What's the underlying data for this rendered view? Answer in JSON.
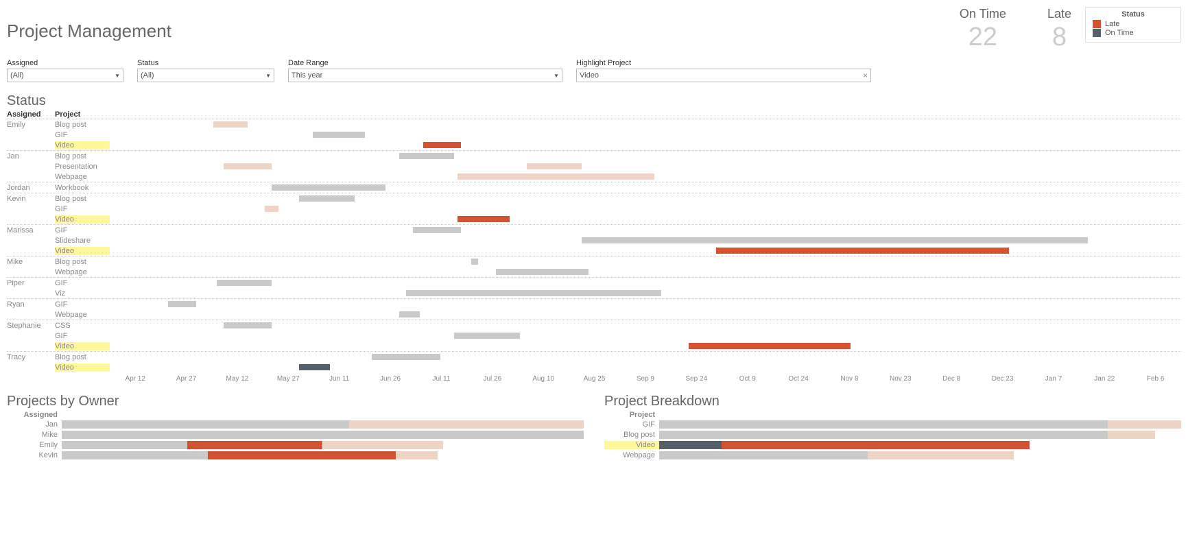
{
  "title": "Project Management",
  "kpis": {
    "ontime_label": "On Time",
    "ontime_value": "22",
    "late_label": "Late",
    "late_value": "8"
  },
  "legend": {
    "title": "Status",
    "late": "Late",
    "ontime": "On Time"
  },
  "filters": {
    "assigned": {
      "label": "Assigned",
      "value": "(All)"
    },
    "status": {
      "label": "Status",
      "value": "(All)"
    },
    "daterange": {
      "label": "Date Range",
      "value": "This year"
    },
    "highlight": {
      "label": "Highlight Project",
      "value": "Video"
    }
  },
  "status_section_title": "Status",
  "gantt_headers": {
    "assigned": "Assigned",
    "project": "Project"
  },
  "axis_labels": [
    "Apr 12",
    "Apr 27",
    "May 12",
    "May 27",
    "Jun 11",
    "Jun 26",
    "Jul 11",
    "Jul 26",
    "Aug 10",
    "Aug 25",
    "Sep 9",
    "Sep 24",
    "Oct 9",
    "Oct 24",
    "Nov 8",
    "Nov 23",
    "Dec 8",
    "Dec 23",
    "Jan 7",
    "Jan 22",
    "Feb 6"
  ],
  "projects_by_owner_title": "Projects by Owner",
  "projects_by_owner_header": "Assigned",
  "project_breakdown_title": "Project Breakdown",
  "project_breakdown_header": "Project",
  "colors": {
    "late": "#d35231",
    "ontime_dark": "#56606a",
    "ontime_light": "#c9c9c9",
    "shadow": "#eed4c4",
    "highlight": "#fff79a"
  },
  "chart_data": [
    {
      "name": "status_gantt",
      "type": "gantt",
      "x_axis_type": "date",
      "x_range": [
        "2023-04-05",
        "2024-02-10"
      ],
      "highlight_project": "Video",
      "rows": [
        {
          "assigned": "Emily",
          "project": "Blog post",
          "bars": [
            {
              "start": "2023-05-05",
              "end": "2023-05-15",
              "status": "shadow"
            }
          ]
        },
        {
          "assigned": "Emily",
          "project": "GIF",
          "bars": [
            {
              "start": "2023-06-03",
              "end": "2023-06-18",
              "status": "ontime"
            }
          ]
        },
        {
          "assigned": "Emily",
          "project": "Video",
          "bars": [
            {
              "start": "2023-07-05",
              "end": "2023-07-16",
              "status": "late"
            }
          ],
          "highlight": true
        },
        {
          "assigned": "Jan",
          "project": "Blog post",
          "bars": [
            {
              "start": "2023-06-28",
              "end": "2023-07-14",
              "status": "ontime"
            }
          ]
        },
        {
          "assigned": "Jan",
          "project": "Presentation",
          "bars": [
            {
              "start": "2023-05-08",
              "end": "2023-05-22",
              "status": "shadow"
            },
            {
              "start": "2023-08-04",
              "end": "2023-08-20",
              "status": "shadow"
            }
          ]
        },
        {
          "assigned": "Jan",
          "project": "Webpage",
          "bars": [
            {
              "start": "2023-07-15",
              "end": "2023-09-10",
              "status": "shadow"
            }
          ]
        },
        {
          "assigned": "Jordan",
          "project": "Workbook",
          "bars": [
            {
              "start": "2023-05-22",
              "end": "2023-06-24",
              "status": "ontime"
            }
          ]
        },
        {
          "assigned": "Kevin",
          "project": "Blog post",
          "bars": [
            {
              "start": "2023-05-30",
              "end": "2023-06-15",
              "status": "ontime"
            }
          ]
        },
        {
          "assigned": "Kevin",
          "project": "GIF",
          "bars": [
            {
              "start": "2023-05-20",
              "end": "2023-05-24",
              "status": "shadow"
            }
          ]
        },
        {
          "assigned": "Kevin",
          "project": "Video",
          "bars": [
            {
              "start": "2023-07-15",
              "end": "2023-07-30",
              "status": "late"
            }
          ],
          "highlight": true
        },
        {
          "assigned": "Marissa",
          "project": "GIF",
          "bars": [
            {
              "start": "2023-07-02",
              "end": "2023-07-16",
              "status": "ontime"
            }
          ]
        },
        {
          "assigned": "Marissa",
          "project": "Slideshare",
          "bars": [
            {
              "start": "2023-08-20",
              "end": "2024-01-14",
              "status": "ontime"
            }
          ]
        },
        {
          "assigned": "Marissa",
          "project": "Video",
          "bars": [
            {
              "start": "2023-09-28",
              "end": "2023-12-22",
              "status": "late"
            }
          ],
          "highlight": true
        },
        {
          "assigned": "Mike",
          "project": "Blog post",
          "bars": [
            {
              "start": "2023-07-19",
              "end": "2023-07-21",
              "status": "ontime"
            }
          ]
        },
        {
          "assigned": "Mike",
          "project": "Webpage",
          "bars": [
            {
              "start": "2023-07-26",
              "end": "2023-08-22",
              "status": "ontime"
            }
          ]
        },
        {
          "assigned": "Piper",
          "project": "GIF",
          "bars": [
            {
              "start": "2023-05-06",
              "end": "2023-05-22",
              "status": "ontime"
            }
          ]
        },
        {
          "assigned": "Piper",
          "project": "Viz",
          "bars": [
            {
              "start": "2023-06-30",
              "end": "2023-09-12",
              "status": "ontime"
            }
          ]
        },
        {
          "assigned": "Ryan",
          "project": "GIF",
          "bars": [
            {
              "start": "2023-04-22",
              "end": "2023-04-30",
              "status": "ontime"
            }
          ]
        },
        {
          "assigned": "Ryan",
          "project": "Webpage",
          "bars": [
            {
              "start": "2023-06-28",
              "end": "2023-07-04",
              "status": "ontime"
            }
          ]
        },
        {
          "assigned": "Stephanie",
          "project": "CSS",
          "bars": [
            {
              "start": "2023-05-08",
              "end": "2023-05-22",
              "status": "ontime"
            }
          ]
        },
        {
          "assigned": "Stephanie",
          "project": "GIF",
          "bars": [
            {
              "start": "2023-07-14",
              "end": "2023-08-02",
              "status": "ontime"
            }
          ]
        },
        {
          "assigned": "Stephanie",
          "project": "Video",
          "bars": [
            {
              "start": "2023-09-20",
              "end": "2023-11-06",
              "status": "late"
            }
          ],
          "highlight": true
        },
        {
          "assigned": "Tracy",
          "project": "Blog post",
          "bars": [
            {
              "start": "2023-06-20",
              "end": "2023-07-10",
              "status": "ontime"
            }
          ]
        },
        {
          "assigned": "Tracy",
          "project": "Video",
          "bars": [
            {
              "start": "2023-05-30",
              "end": "2023-06-08",
              "status": "ontime_dark"
            }
          ],
          "highlight": true
        }
      ]
    },
    {
      "name": "projects_by_owner",
      "type": "stacked_bar_horizontal",
      "x_max": 100,
      "series_colors": {
        "ontime": "#c9c9c9",
        "late": "#d35231",
        "shadow": "#eed4c4"
      },
      "rows": [
        {
          "label": "Jan",
          "segments": [
            {
              "status": "ontime",
              "value": 55
            },
            {
              "status": "shadow",
              "value": 45
            }
          ]
        },
        {
          "label": "Mike",
          "segments": [
            {
              "status": "ontime",
              "value": 100
            }
          ]
        },
        {
          "label": "Emily",
          "segments": [
            {
              "status": "ontime",
              "value": 24
            },
            {
              "status": "late",
              "value": 26
            },
            {
              "status": "shadow",
              "value": 23
            }
          ]
        },
        {
          "label": "Kevin",
          "segments": [
            {
              "status": "ontime",
              "value": 28
            },
            {
              "status": "late",
              "value": 36
            },
            {
              "status": "shadow",
              "value": 8
            }
          ]
        }
      ]
    },
    {
      "name": "project_breakdown",
      "type": "stacked_bar_horizontal",
      "x_max": 100,
      "series_colors": {
        "ontime": "#c9c9c9",
        "ontime_dark": "#56606a",
        "late": "#d35231",
        "shadow": "#eed4c4"
      },
      "rows": [
        {
          "label": "GIF",
          "segments": [
            {
              "status": "ontime",
              "value": 86
            },
            {
              "status": "shadow",
              "value": 14
            }
          ]
        },
        {
          "label": "Blog post",
          "segments": [
            {
              "status": "ontime",
              "value": 86
            },
            {
              "status": "shadow",
              "value": 9
            }
          ]
        },
        {
          "label": "Video",
          "segments": [
            {
              "status": "ontime_dark",
              "value": 12
            },
            {
              "status": "late",
              "value": 59
            }
          ],
          "highlight": true
        },
        {
          "label": "Webpage",
          "segments": [
            {
              "status": "ontime",
              "value": 40
            },
            {
              "status": "shadow",
              "value": 28
            }
          ]
        }
      ]
    }
  ]
}
